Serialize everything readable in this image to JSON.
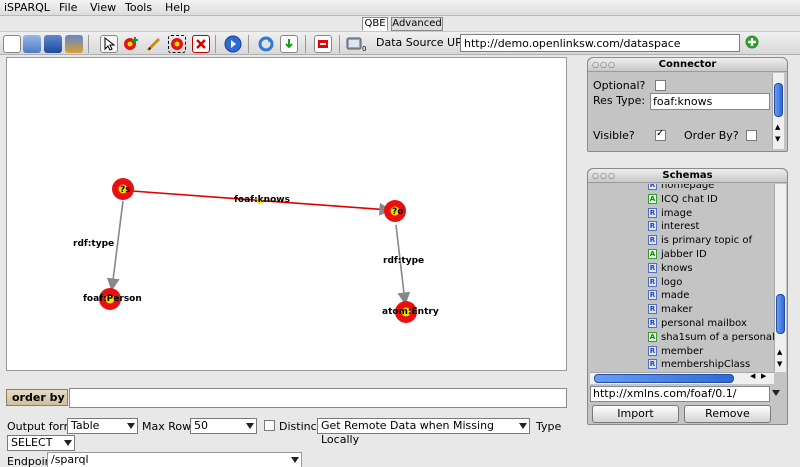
{
  "menu": [
    "iSPARQL",
    "File",
    "View",
    "Tools",
    "Help"
  ],
  "tabs": {
    "qbe": "QBE",
    "advanced": "Advanced"
  },
  "toolbar": {
    "icons": [
      "new-file-icon",
      "open-folder-icon",
      "save-icon",
      "save-as-icon",
      "select-arrow-icon",
      "add-node-icon",
      "draw-edge-icon",
      "group-icon",
      "delete-icon",
      "run-query-icon",
      "refresh-icon",
      "import-icon",
      "clear-icon",
      "datasource-icon"
    ],
    "data_source_label": "Data Source URI",
    "data_source_value": "http://demo.openlinksw.com/dataspace",
    "add_icon": "green-plus-icon"
  },
  "graph": {
    "nodes": [
      {
        "label": "?s"
      },
      {
        "label": "?o"
      },
      {
        "label": "foaf:Person"
      },
      {
        "label": "atom:Entry"
      }
    ],
    "edges": [
      {
        "label": "foaf:knows",
        "color": "#e00000"
      },
      {
        "label": "rdf:type",
        "color": "#888888"
      },
      {
        "label": "rdf:type",
        "color": "#888888"
      }
    ]
  },
  "order_by": {
    "label": "order by",
    "value": ""
  },
  "options": {
    "output_format_label": "Output format",
    "output_format_value": "Table",
    "max_rows_label": "Max Rows",
    "max_rows_value": "50",
    "distinct_label": "Distinct",
    "distinct_checked": false,
    "remote_value": "Get Remote Data when Missing Locally",
    "type_label": "Type",
    "type_value": "SELECT",
    "endpoint_label": "Endpoint",
    "endpoint_value": "/sparql"
  },
  "connector": {
    "title": "Connector",
    "optional_label": "Optional?",
    "optional_checked": false,
    "res_type_label": "Res Type:",
    "res_type_value": "foaf:knows",
    "visible_label": "Visible?",
    "visible_checked": true,
    "order_by_label": "Order By?",
    "order_by_checked": false
  },
  "schemas": {
    "title": "Schemas",
    "items": [
      {
        "type": "R",
        "label": "homepage"
      },
      {
        "type": "A",
        "label": "ICQ chat ID"
      },
      {
        "type": "R",
        "label": "image"
      },
      {
        "type": "R",
        "label": "interest"
      },
      {
        "type": "R",
        "label": "is primary topic of"
      },
      {
        "type": "A",
        "label": "jabber ID"
      },
      {
        "type": "R",
        "label": "knows"
      },
      {
        "type": "R",
        "label": "logo"
      },
      {
        "type": "R",
        "label": "made"
      },
      {
        "type": "R",
        "label": "maker"
      },
      {
        "type": "R",
        "label": "personal mailbox"
      },
      {
        "type": "A",
        "label": "sha1sum of a personal"
      },
      {
        "type": "R",
        "label": "member"
      },
      {
        "type": "R",
        "label": "membershipClass"
      }
    ],
    "uri_value": "http://xmlns.com/foaf/0.1/",
    "import_label": "Import",
    "remove_label": "Remove"
  },
  "colors": {
    "node_outer": "#e81010",
    "node_inner": "#f3e200",
    "accent": "#2e6ad6"
  }
}
